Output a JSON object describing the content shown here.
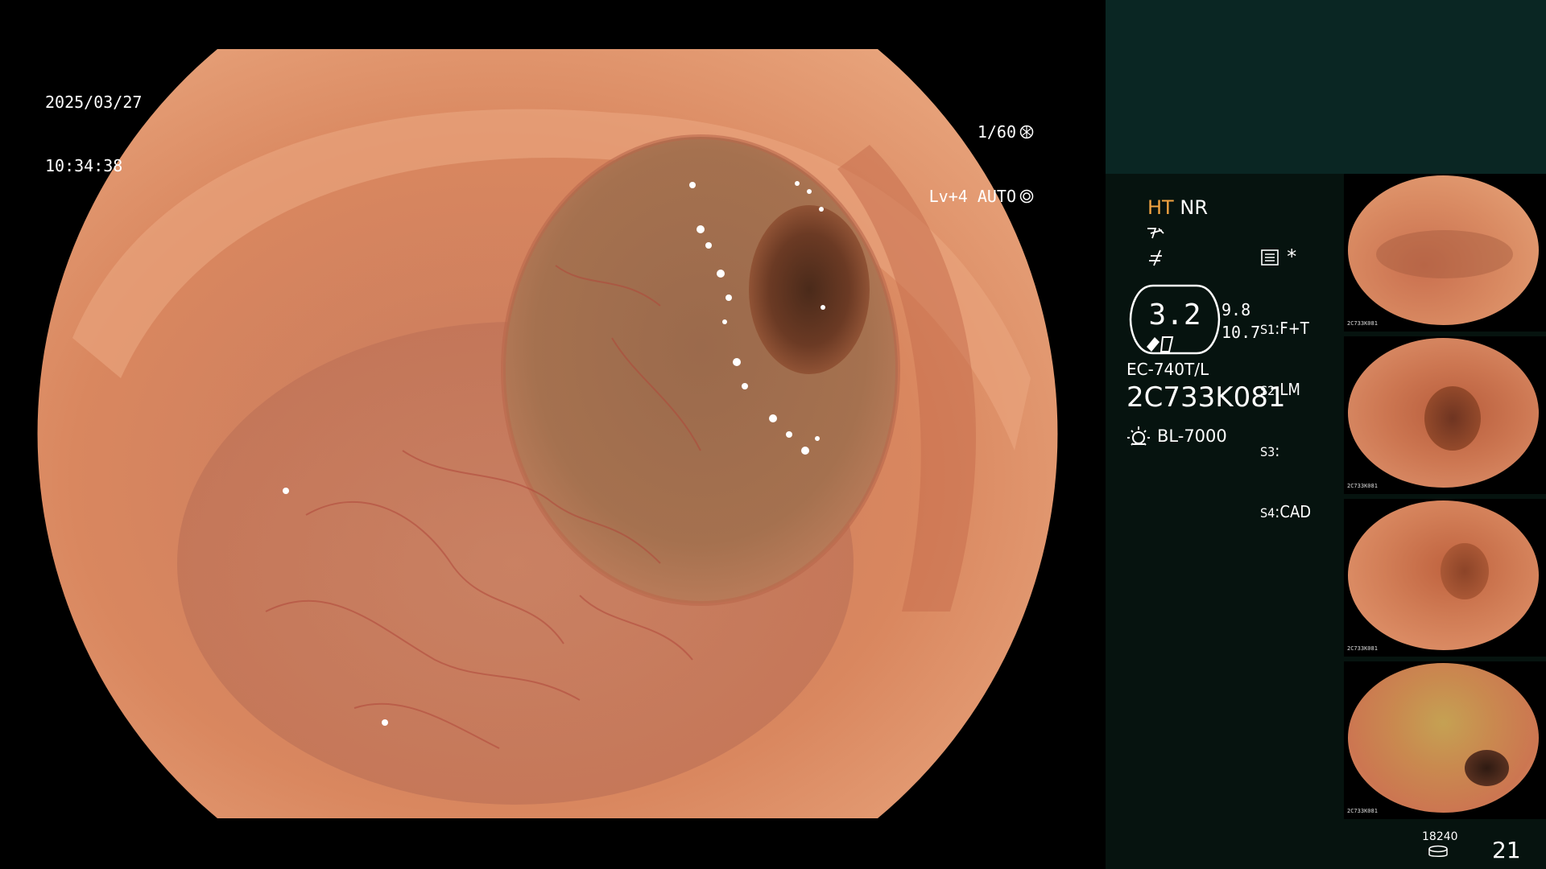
{
  "osd": {
    "date": "2025/03/27",
    "time": "10:34:38",
    "shutter": "1/60",
    "shutter_icon": "aperture-icon",
    "level": "Lv+4 AUTO",
    "level_icon": "iris-icon"
  },
  "sidebar": {
    "ht": "HT",
    "nr": "NR",
    "ht_color": "#f2a341",
    "icons": [
      "enhancement-icon",
      "noise-filter-icon",
      "menu-icon"
    ],
    "star": "*",
    "zoom": {
      "value": "3.2",
      "side_top": "9.8",
      "side_bottom": "10.7"
    },
    "slots": [
      {
        "key": "S1",
        "value": "F+T"
      },
      {
        "key": "S2",
        "value": "LM"
      },
      {
        "key": "S3",
        "value": ""
      },
      {
        "key": "S4",
        "value": "CAD"
      }
    ],
    "scope_model": "EC-740T/L",
    "scope_serial": "2C733K081",
    "light_source": "BL-7000",
    "counter_small": "18240",
    "counter_big": "21"
  },
  "thumbnails": [
    {
      "label": "thumbnail-1",
      "meta": "2C733K081"
    },
    {
      "label": "thumbnail-2",
      "meta": "2C733K081"
    },
    {
      "label": "thumbnail-3",
      "meta": "2C733K081"
    },
    {
      "label": "thumbnail-4",
      "meta": "2C733K081"
    }
  ]
}
